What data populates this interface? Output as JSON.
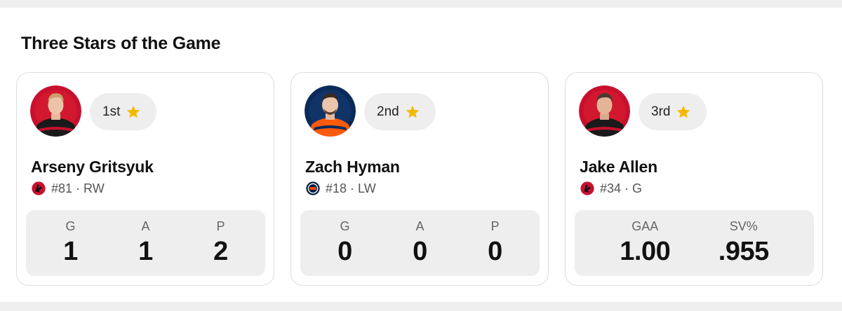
{
  "section": {
    "title": "Three Stars of the Game"
  },
  "stars": [
    {
      "rank": "1st",
      "name": "Arseny Gritsyuk",
      "number_position": "#81 · RW",
      "team_logo": "new-jersey-devils-logo",
      "jersey_color": "#c8102e",
      "stats": [
        {
          "label": "G",
          "value": "1"
        },
        {
          "label": "A",
          "value": "1"
        },
        {
          "label": "P",
          "value": "2"
        }
      ]
    },
    {
      "rank": "2nd",
      "name": "Zach Hyman",
      "number_position": "#18 · LW",
      "team_logo": "edmonton-oilers-logo",
      "jersey_color": "#ff4c00",
      "stats": [
        {
          "label": "G",
          "value": "0"
        },
        {
          "label": "A",
          "value": "0"
        },
        {
          "label": "P",
          "value": "0"
        }
      ]
    },
    {
      "rank": "3rd",
      "name": "Jake Allen",
      "number_position": "#34 · G",
      "team_logo": "new-jersey-devils-logo",
      "jersey_color": "#c8102e",
      "stats": [
        {
          "label": "GAA",
          "value": "1.00"
        },
        {
          "label": "SV%",
          "value": ".955"
        }
      ]
    }
  ],
  "colors": {
    "star": "#f5b800",
    "devils_red": "#c8102e",
    "oilers_blue": "#041e42",
    "oilers_orange": "#ff4c00"
  },
  "icons": {
    "rank": "star-icon"
  }
}
